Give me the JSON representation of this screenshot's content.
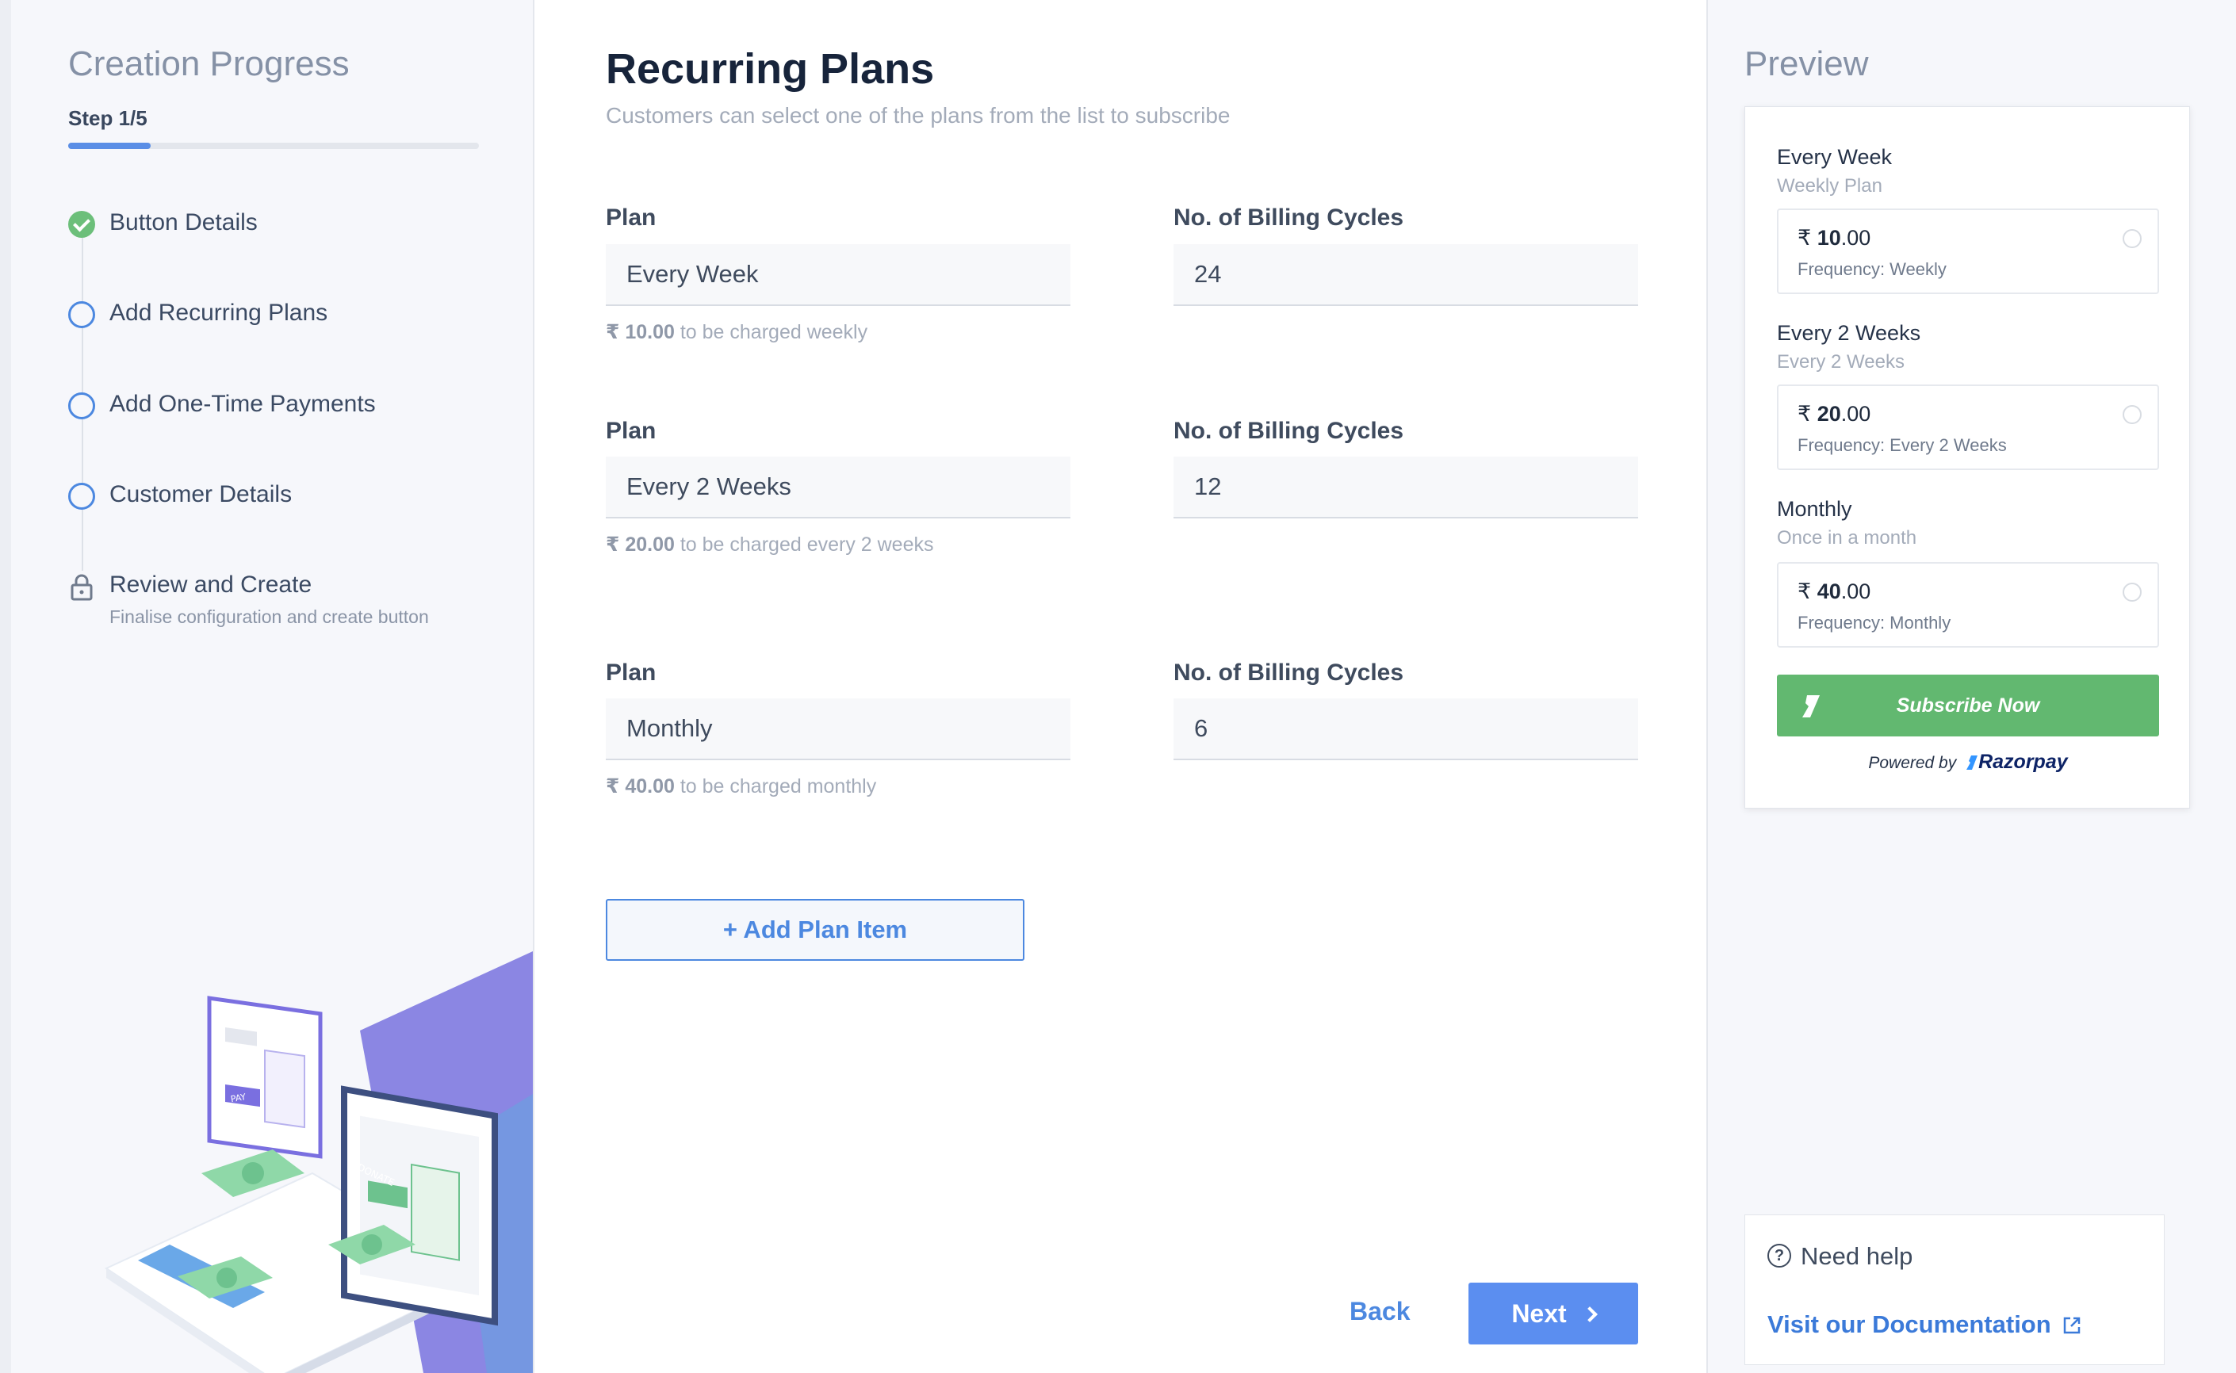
{
  "progress": {
    "title": "Creation Progress",
    "step_label": "Step 1/5",
    "fraction": 0.2,
    "steps": [
      {
        "label": "Button Details",
        "status": "done"
      },
      {
        "label": "Add Recurring Plans",
        "status": "pending"
      },
      {
        "label": "Add One-Time Payments",
        "status": "pending"
      },
      {
        "label": "Customer Details",
        "status": "pending"
      },
      {
        "label": "Review and Create",
        "subtitle": "Finalise configuration and create button",
        "status": "locked"
      }
    ],
    "illustration_text": {
      "pay": "PAY",
      "donate": "DONATE"
    }
  },
  "main": {
    "title": "Recurring Plans",
    "subtitle": "Customers can select one of the plans from the list to subscribe",
    "plan_label": "Plan",
    "cycles_label": "No. of Billing Cycles",
    "plans": [
      {
        "plan": "Every Week",
        "cycles": "24",
        "amount": "₹ 10.00",
        "charge_text": " to be charged weekly"
      },
      {
        "plan": "Every 2 Weeks",
        "cycles": "12",
        "amount": "₹ 20.00",
        "charge_text": " to be charged every 2 weeks"
      },
      {
        "plan": "Monthly",
        "cycles": "6",
        "amount": "₹ 40.00",
        "charge_text": " to be charged monthly"
      }
    ],
    "add_button": "+ Add Plan Item",
    "back": "Back",
    "next": "Next"
  },
  "preview": {
    "title": "Preview",
    "plans": [
      {
        "name": "Every Week",
        "desc": "Weekly Plan",
        "currency": "₹",
        "whole": "10",
        "decimal": ".00",
        "freq": "Frequency: Weekly"
      },
      {
        "name": "Every 2 Weeks",
        "desc": "Every 2 Weeks",
        "currency": "₹",
        "whole": "20",
        "decimal": ".00",
        "freq": "Frequency: Every 2 Weeks"
      },
      {
        "name": "Monthly",
        "desc": "Once in a month",
        "currency": "₹",
        "whole": "40",
        "decimal": ".00",
        "freq": "Frequency: Monthly"
      }
    ],
    "subscribe": "Subscribe Now",
    "powered_by": "Powered by",
    "brand": "Razorpay"
  },
  "help": {
    "text": "Need help",
    "link": "Visit our Documentation"
  },
  "colors": {
    "accent": "#4c88e0",
    "success": "#62b870",
    "brand_navy": "#0d2366"
  },
  "icons": [
    "check-circle-icon",
    "circle-icon",
    "lock-icon",
    "chevron-right-icon",
    "razorpay-logo-icon",
    "question-icon",
    "external-link-icon",
    "radio-circle-icon"
  ]
}
